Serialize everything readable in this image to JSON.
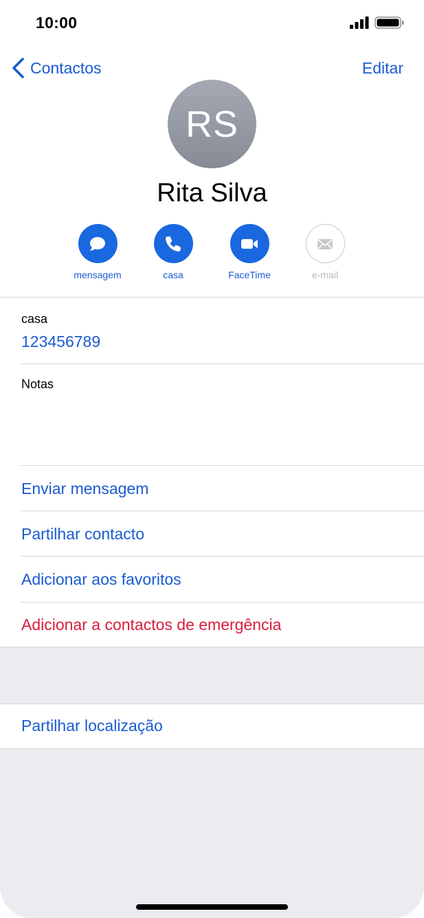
{
  "status": {
    "time": "10:00"
  },
  "nav": {
    "back_label": "Contactos",
    "edit_label": "Editar"
  },
  "contact": {
    "initials": "RS",
    "name": "Rita Silva"
  },
  "actions": [
    {
      "label": "mensagem",
      "icon": "message-icon"
    },
    {
      "label": "casa",
      "icon": "phone-icon"
    },
    {
      "label": "FaceTime",
      "icon": "video-icon"
    },
    {
      "label": "e-mail",
      "icon": "mail-icon"
    }
  ],
  "phone": {
    "label": "casa",
    "value": "123456789"
  },
  "notes": {
    "label": "Notas"
  },
  "links": {
    "send_message": "Enviar mensagem",
    "share_contact": "Partilhar contacto",
    "add_favorites": "Adicionar aos favoritos",
    "add_emergency": "Adicionar a contactos de emergência",
    "share_location": "Partilhar localização"
  },
  "colors": {
    "accent": "#1a5bd0",
    "destructive": "#d81e3b",
    "group_background": "#ebebf0"
  }
}
